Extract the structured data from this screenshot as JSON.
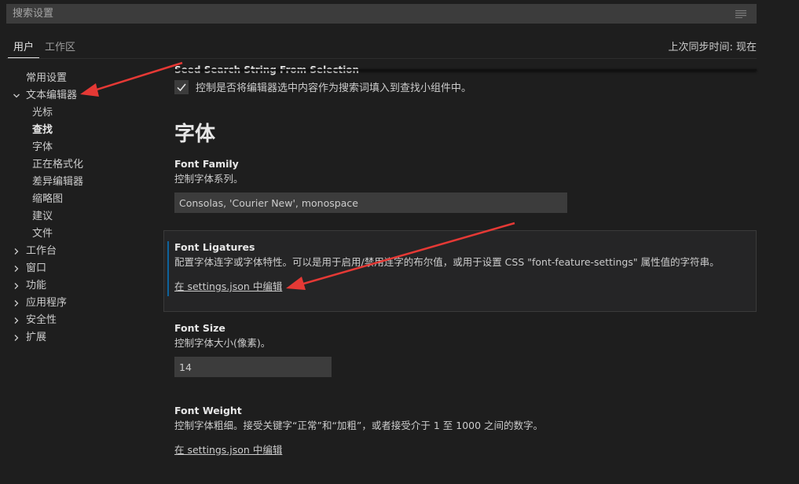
{
  "search": {
    "placeholder": "搜索设置",
    "filter_icon": "filter-list-icon"
  },
  "tabs": [
    {
      "label": "用户",
      "active": true
    },
    {
      "label": "工作区",
      "active": false
    }
  ],
  "sync_status": "上次同步时间: 现在",
  "toc": {
    "items": [
      {
        "label": "常用设置",
        "level": 0,
        "chevron": "none",
        "bold": false
      },
      {
        "label": "文本编辑器",
        "level": 0,
        "chevron": "down",
        "bold": false
      },
      {
        "label": "光标",
        "level": 1,
        "chevron": "none",
        "bold": false
      },
      {
        "label": "查找",
        "level": 1,
        "chevron": "none",
        "bold": true
      },
      {
        "label": "字体",
        "level": 1,
        "chevron": "none",
        "bold": false
      },
      {
        "label": "正在格式化",
        "level": 1,
        "chevron": "none",
        "bold": false
      },
      {
        "label": "差异编辑器",
        "level": 1,
        "chevron": "none",
        "bold": false
      },
      {
        "label": "缩略图",
        "level": 1,
        "chevron": "none",
        "bold": false
      },
      {
        "label": "建议",
        "level": 1,
        "chevron": "none",
        "bold": false
      },
      {
        "label": "文件",
        "level": 1,
        "chevron": "none",
        "bold": false
      },
      {
        "label": "工作台",
        "level": 0,
        "chevron": "right",
        "bold": false
      },
      {
        "label": "窗口",
        "level": 0,
        "chevron": "right",
        "bold": false
      },
      {
        "label": "功能",
        "level": 0,
        "chevron": "right",
        "bold": false
      },
      {
        "label": "应用程序",
        "level": 0,
        "chevron": "right",
        "bold": false
      },
      {
        "label": "安全性",
        "level": 0,
        "chevron": "right",
        "bold": false
      },
      {
        "label": "扩展",
        "level": 0,
        "chevron": "right",
        "bold": false
      }
    ]
  },
  "content": {
    "seed_search": {
      "label": "Seed Search String From Selection",
      "description": "控制是否将编辑器选中内容作为搜索词填入到查找小组件中。",
      "checked": true
    },
    "section_heading": "字体",
    "font_family": {
      "label": "Font Family",
      "description": "控制字体系列。",
      "value": "Consolas, 'Courier New', monospace"
    },
    "font_ligatures": {
      "label": "Font Ligatures",
      "description": "配置字体连字或字体特性。可以是用于启用/禁用连字的布尔值，或用于设置 CSS \"font-feature-settings\" 属性值的字符串。",
      "link": "在 settings.json 中编辑"
    },
    "font_size": {
      "label": "Font Size",
      "description": "控制字体大小(像素)。",
      "value": "14"
    },
    "font_weight": {
      "label": "Font Weight",
      "description": "控制字体粗细。接受关键字“正常”和“加粗”，或者接受介于 1 至 1000 之间的数字。",
      "link": "在 settings.json 中编辑"
    }
  },
  "colors": {
    "background": "#1e1e1e",
    "input_background": "#3c3c3c",
    "focus_accent": "#0e639c",
    "annotation_arrow": "#e53935"
  }
}
